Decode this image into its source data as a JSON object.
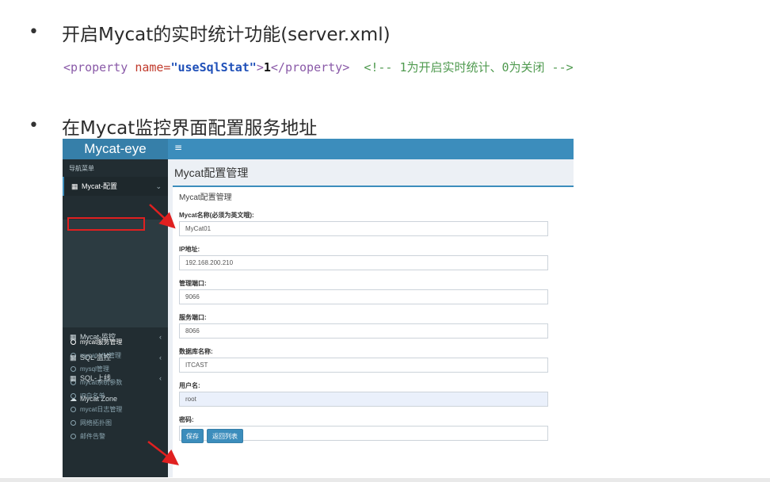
{
  "slide": {
    "bullet1": "•",
    "heading1": "开启Mycat的实时统计功能(server.xml)",
    "code": {
      "open_tag": "<property ",
      "attr": "name=",
      "attr_value": "\"useSqlStat\"",
      "close_bracket": ">",
      "value": "1",
      "end_tag": "</property>",
      "comment": "<!-- 1为开启实时统计、0为关闭 -->"
    },
    "bullet2": "•",
    "heading2": "在Mycat监控界面配置服务地址"
  },
  "app": {
    "logo": "Mycat-eye",
    "menu_toggle": "≡",
    "sidebar": {
      "header": "导航菜单",
      "menus": [
        {
          "label": "Mycat-配置",
          "icon": "grid-icon",
          "chevron": "⌄"
        },
        {
          "label": "Mycat-监控",
          "icon": "grid-icon",
          "chevron": "‹"
        },
        {
          "label": "SQL-监控",
          "icon": "grid-icon",
          "chevron": "‹"
        },
        {
          "label": "SQL-上线",
          "icon": "grid-icon",
          "chevron": "‹"
        },
        {
          "label": "Mycat Zone",
          "icon": "cloud-icon",
          "chevron": ""
        }
      ],
      "submenu": [
        "mycat服务管理",
        "mycat-VM管理",
        "mysql管理",
        "mycat系统参数",
        "IP白名单",
        "mycat日志管理",
        "网络拓扑图",
        "邮件告警"
      ]
    },
    "page_title": "Mycat配置管理",
    "box_title": "Mycat配置管理",
    "form": {
      "name_label": "Mycat名称(必须为英文哦):",
      "name_value": "MyCat01",
      "ip_label": "IP地址:",
      "ip_value": "192.168.200.210",
      "mgmt_port_label": "管理端口:",
      "mgmt_port_value": "9066",
      "service_port_label": "服务端口:",
      "service_port_value": "8066",
      "db_label": "数据库名称:",
      "db_value": "ITCAST",
      "user_label": "用户名:",
      "user_value": "root",
      "password_label": "密码:",
      "password_value": "••••••"
    },
    "buttons": {
      "save": "保存",
      "back": "返回列表"
    }
  },
  "colors": {
    "topbar": "#3c8dbc",
    "sidebar": "#222d32",
    "highlight": "#e02020"
  }
}
